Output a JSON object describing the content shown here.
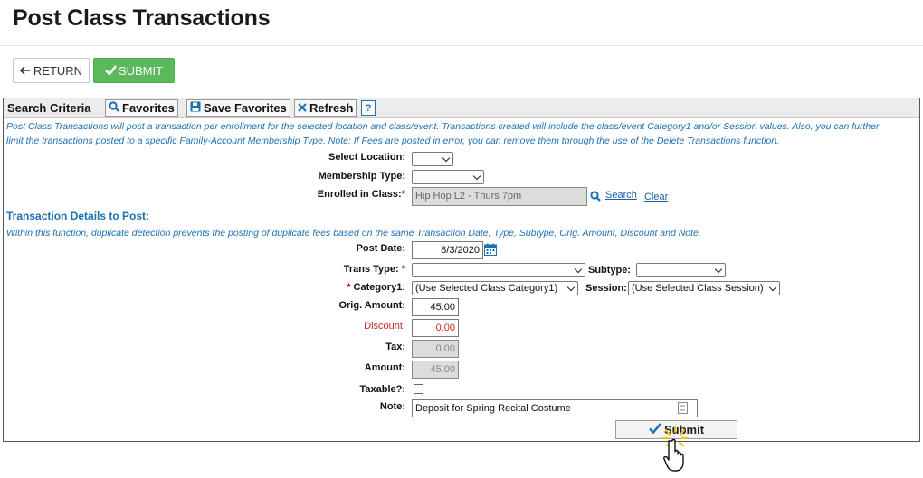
{
  "page": {
    "title": "Post Class Transactions",
    "return_label": "RETURN",
    "submit_label": "SUBMIT"
  },
  "toolbar": {
    "section_label": "Search Criteria",
    "favorites_label": "Favorites",
    "save_favorites_label": "Save Favorites",
    "refresh_label": "Refresh",
    "help_label": "?"
  },
  "info": {
    "line1": "Post Class Transactions will post a transaction per enrollment for the selected location and class/event. Transactions created will include the class/event Category1 and/or Session values.  Also, you can further",
    "line2": "limit the transactions posted to a specific Family-Account Membership Type.  Note: If Fees are posted in error, you can remove them through the use of the Delete Transactions function."
  },
  "search": {
    "location_label": "Select Location:",
    "location_value": "",
    "membership_label": "Membership Type:",
    "membership_value": "",
    "class_label": "Enrolled in Class:",
    "class_value": "Hip Hop L2 - Thurs 7pm",
    "search_link": "Search",
    "clear_link": "Clear"
  },
  "details": {
    "heading": "Transaction Details to Post:",
    "note": "Within this function, duplicate detection prevents the posting of duplicate fees based on the same Transaction Date, Type, Subtype, Orig. Amount, Discount and Note.",
    "post_date_label": "Post Date:",
    "post_date_value": "8/3/2020",
    "trans_type_label": "Trans Type:",
    "trans_type_value": "",
    "subtype_label": "Subtype:",
    "subtype_value": "",
    "category_label": "Category1:",
    "category_value": "(Use Selected Class Category1)",
    "session_label": "Session:",
    "session_value": "(Use Selected Class Session)",
    "orig_amount_label": "Orig. Amount:",
    "orig_amount_value": "45.00",
    "discount_label": "Discount:",
    "discount_value": "0.00",
    "tax_label": "Tax:",
    "tax_value": "0.00",
    "amount_label": "Amount:",
    "amount_value": "45.00",
    "taxable_label": "Taxable?:",
    "note_label": "Note:",
    "note_value": "Deposit for Spring Recital Costume",
    "submit_label": "Submit"
  },
  "colors": {
    "accent_blue": "#1b6fb3",
    "submit_green": "#5cb85c",
    "required_red": "#c00000"
  }
}
